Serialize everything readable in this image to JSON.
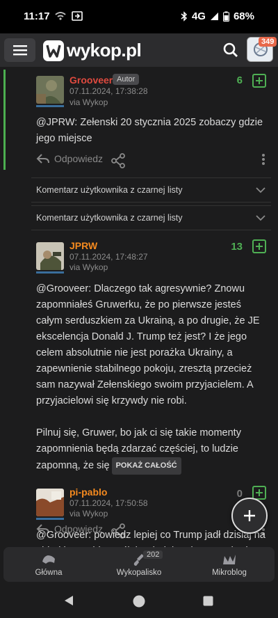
{
  "status_bar": {
    "time": "11:17",
    "network": "4G",
    "battery": "68%"
  },
  "header": {
    "logo_text": "wykop.pl",
    "notification_count": "349"
  },
  "comments": [
    {
      "username": "Grooveer",
      "badge": "Autor",
      "date": "07.11.2024, 17:38:28",
      "via": "via Wykop",
      "votes": "6",
      "text": "@JPRW: Zełenski 20 stycznia 2025 zobaczy gdzie jego miejsce",
      "reply_label": "Odpowiedz"
    },
    {
      "username": "JPRW",
      "date": "07.11.2024, 17:48:27",
      "via": "via Wykop",
      "votes": "13",
      "text_p1": "@Grooveer: Dlaczego tak agresywnie? Znowu zapomniałeś Gruwerku, że po pierwsze jesteś całym serduszkiem za Ukrainą, a po drugie, że JE ekscelencja Donald J. Trump też jest? I że jego celem absolutnie nie jest porażka Ukrainy, a zapewnienie stabilnego pokoju, zresztą przecież sam nazywał Zełenskiego swoim przyjacielem. A przyjacielowi się krzywdy nie robi.",
      "text_p2": "Pilnuj się, Gruwer, bo jak ci się takie momenty zapomnienia będą zdarzać częściej, to ludzie zapomną, że się",
      "show_all": "POKAŻ CAŁOŚĆ",
      "reply_label": "Odpowiedz"
    },
    {
      "username": "pi-pablo",
      "date": "07.11.2024, 17:50:58",
      "via": "via Wykop",
      "votes": "0",
      "text": "@Grooveer: powiedz lepiej co Trump jadł dzisiaj na obiad i co sobie myślał wsiadając do samochodu"
    }
  ],
  "blacklist": [
    {
      "label": "Komentarz użytkownika z czarnej listy"
    },
    {
      "label": "Komentarz użytkownika z czarnej listy"
    }
  ],
  "bottom_nav": [
    {
      "label": "Główna",
      "icon": "home-icon"
    },
    {
      "label": "Wykopalisko",
      "icon": "shovel-icon",
      "badge": "202"
    },
    {
      "label": "Mikroblog",
      "icon": "mikroblog-icon"
    }
  ],
  "colors": {
    "accent_green": "#4fb054",
    "author_red": "#e04a3f",
    "user_orange": "#f58a1f"
  }
}
